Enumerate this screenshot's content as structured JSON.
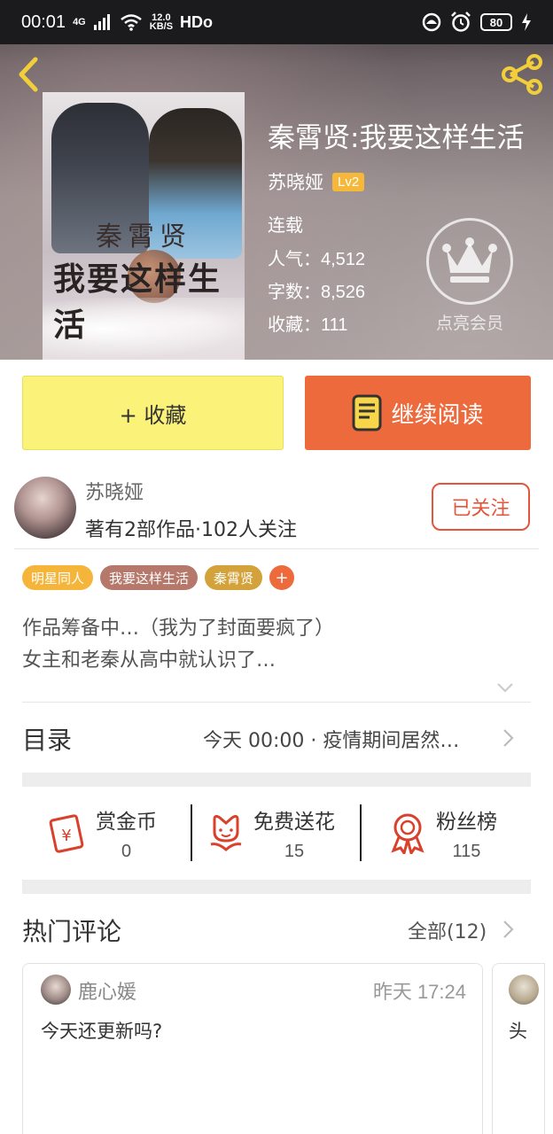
{
  "status_bar": {
    "time": "00:01",
    "network": "4G",
    "speed_top": "12.0",
    "speed_bottom": "KB/S",
    "hd": "HDo",
    "battery": "80"
  },
  "book": {
    "title": "秦霄贤:我要这样生活",
    "author": "苏晓娅",
    "level": "Lv2",
    "status": "连载",
    "popularity_label": "人气：",
    "popularity": "4,512",
    "words_label": "字数：",
    "words": "8,526",
    "favorites_label": "收藏：",
    "favorites": "111",
    "cover_line1": "秦霄贤",
    "cover_line2": "我要这样生活"
  },
  "vip": {
    "label": "点亮会员"
  },
  "actions": {
    "collect_label": "+ 收藏",
    "read_label": "继续阅读"
  },
  "author": {
    "name": "苏晓娅",
    "stats": "著有2部作品·102人关注",
    "follow_label": "已关注"
  },
  "tags": [
    {
      "label": "明星同人",
      "color": "#f5b53b"
    },
    {
      "label": "我要这样生活",
      "color": "#b5786b"
    },
    {
      "label": "秦霄贤",
      "color": "#d4a23a"
    }
  ],
  "tag_plus": "+",
  "description": {
    "line1": "作品筹备中…（我为了封面要疯了）",
    "line2": "女主和老秦从高中就认识了…"
  },
  "catalog": {
    "title": "目录",
    "latest": "今天 00:00 · 疫情期间居然…"
  },
  "stats": [
    {
      "label": "赏金币",
      "value": "0",
      "icon": "red-envelope-icon"
    },
    {
      "label": "免费送花",
      "value": "15",
      "icon": "flower-icon"
    },
    {
      "label": "粉丝榜",
      "value": "115",
      "icon": "medal-icon"
    }
  ],
  "comments": {
    "title": "热门评论",
    "all_label": "全部(12)",
    "items": [
      {
        "user": "鹿心媛",
        "time": "昨天 17:24",
        "text": "今天还更新吗?"
      },
      {
        "text": "头"
      }
    ]
  },
  "colors": {
    "accent_orange": "#ec6a3c",
    "collect_yellow": "#fbf27a",
    "follow_red": "#e4553b",
    "lv_badge": "#f5b83a",
    "icon_red": "#d9412c"
  }
}
